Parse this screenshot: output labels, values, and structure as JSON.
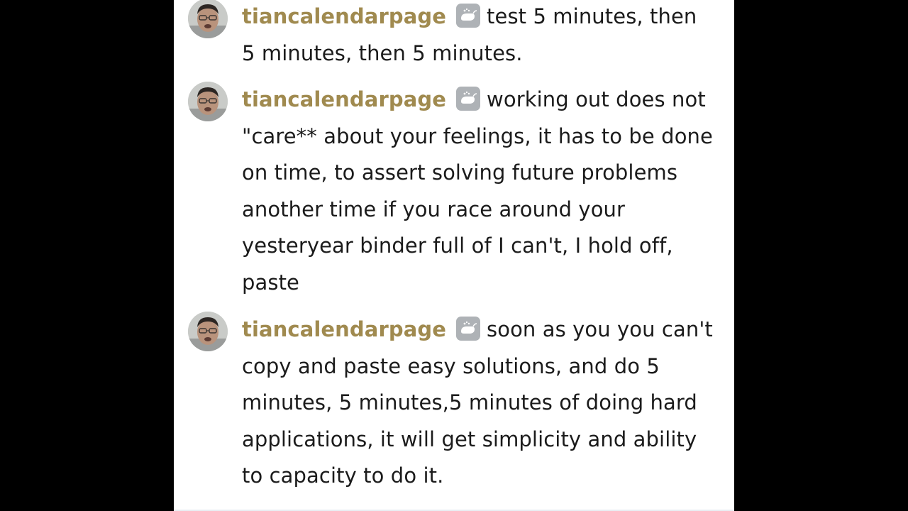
{
  "messages": [
    {
      "username": "tiancalendarpage",
      "badge_icon": "whale-badge-icon",
      "text": "test 5 minutes, then 5 minutes, then 5 minutes."
    },
    {
      "username": "tiancalendarpage",
      "badge_icon": "whale-badge-icon",
      "text": "working out does not \"care** about your feelings, it has to be done on time, to assert solving future problems another time if you race around your yesteryear binder full of I can't, I hold off, paste"
    },
    {
      "username": "tiancalendarpage",
      "badge_icon": "whale-badge-icon",
      "text": "soon as you you can't copy and paste easy solutions, and do 5 minutes, 5 minutes,5 minutes of doing hard applications, it will get simplicity and ability to capacity to do it."
    }
  ],
  "colors": {
    "background": "#000000",
    "panel": "#ffffff",
    "username": "#a08a4f",
    "message_text": "#1b1b1b",
    "badge": "#aeb2b6"
  }
}
